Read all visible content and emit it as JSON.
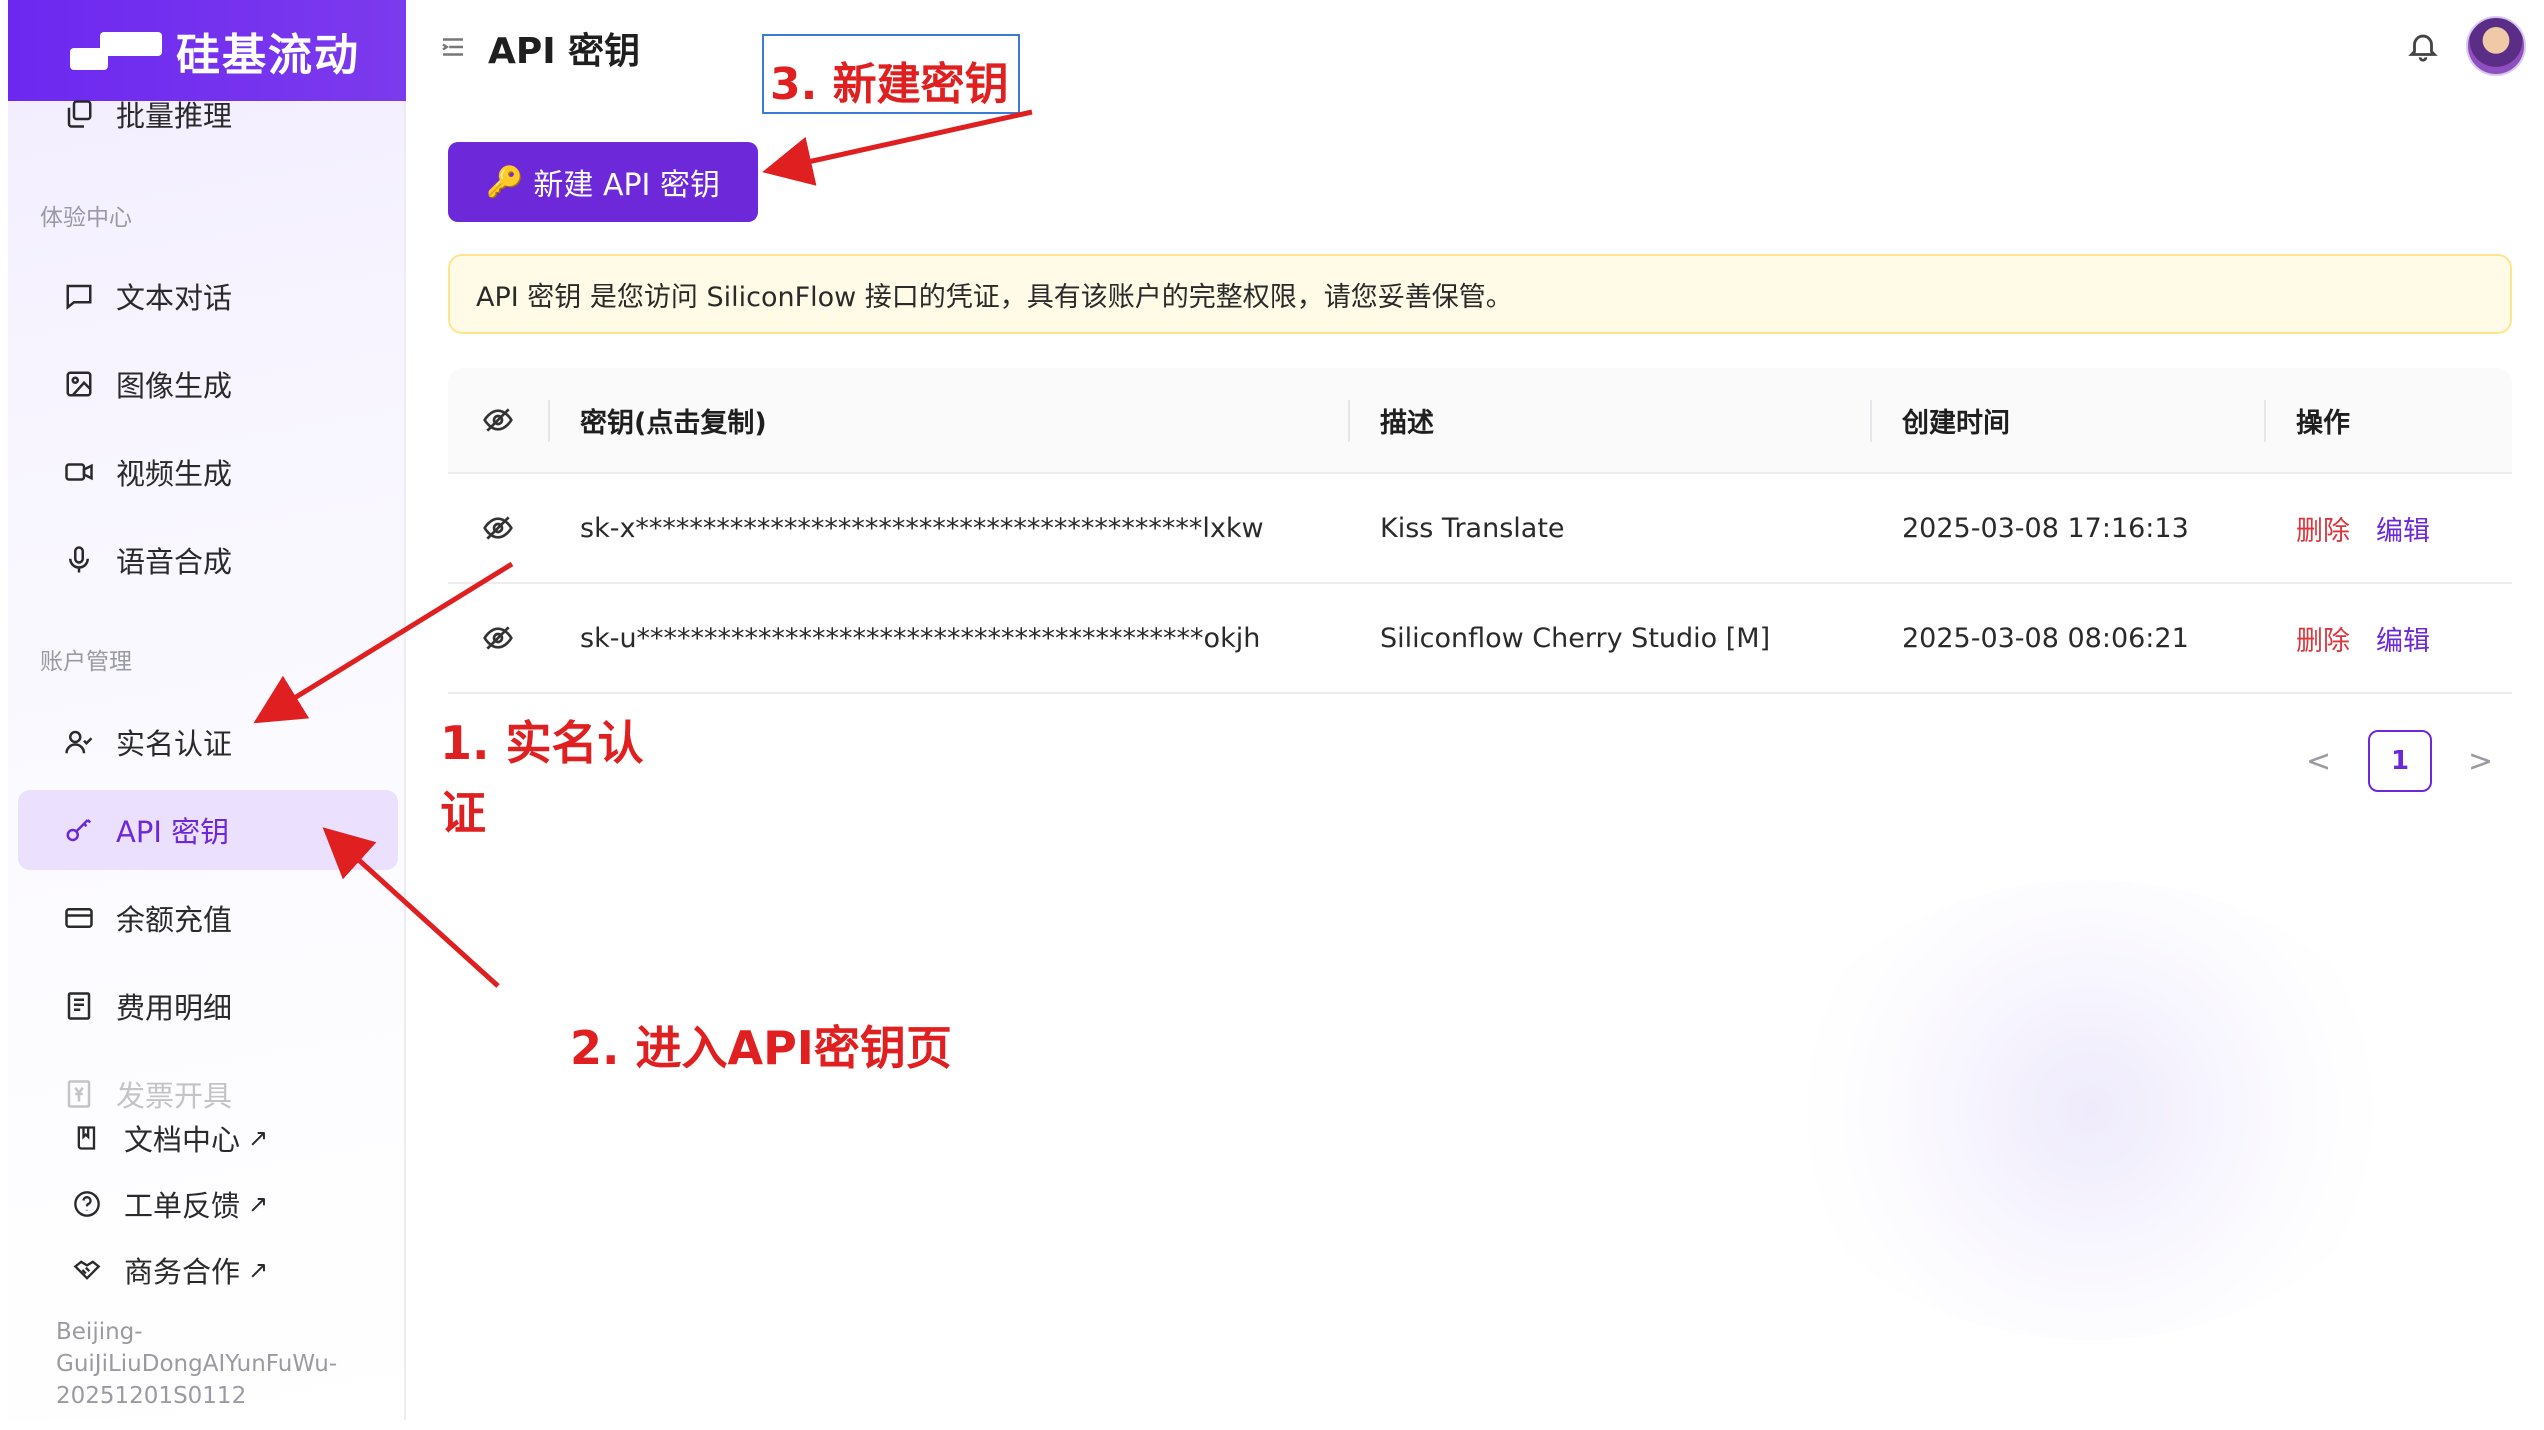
{
  "brand": {
    "name": "硅基流动"
  },
  "header": {
    "title": "API 密钥"
  },
  "sidebar": {
    "items_top": [
      {
        "label": "批量推理",
        "icon": "copy-stack-icon"
      }
    ],
    "section_experience": "体验中心",
    "experience_items": [
      {
        "label": "文本对话",
        "icon": "chat-icon"
      },
      {
        "label": "图像生成",
        "icon": "image-icon"
      },
      {
        "label": "视频生成",
        "icon": "video-icon"
      },
      {
        "label": "语音合成",
        "icon": "microphone-icon"
      }
    ],
    "section_account": "账户管理",
    "account_items": [
      {
        "label": "实名认证",
        "icon": "user-check-icon"
      },
      {
        "label": "API 密钥",
        "icon": "key-icon",
        "active": true
      },
      {
        "label": "余额充值",
        "icon": "card-icon"
      },
      {
        "label": "费用明细",
        "icon": "receipt-icon"
      },
      {
        "label": "发票开具",
        "icon": "invoice-icon",
        "disabled": true
      }
    ],
    "links": [
      {
        "label": "文档中心",
        "ext": "↗",
        "icon": "book-icon"
      },
      {
        "label": "工单反馈",
        "ext": "↗",
        "icon": "help-icon"
      },
      {
        "label": "商务合作",
        "ext": "↗",
        "icon": "handshake-icon"
      }
    ],
    "footer": "Beijing-GuiJiLiuDongAIYunFuWu-20251201S0112"
  },
  "main": {
    "new_button": "新建 API 密钥",
    "notice": "API 密钥 是您访问 SiliconFlow 接口的凭证，具有该账户的完整权限，请您妥善保管。",
    "table": {
      "headers": [
        "密钥(点击复制)",
        "描述",
        "创建时间",
        "操作"
      ],
      "rows": [
        {
          "key": "sk-x******************************************lxkw",
          "desc": "Kiss Translate",
          "created": "2025-03-08 17:16:13",
          "delete": "删除",
          "edit": "编辑"
        },
        {
          "key": "sk-u******************************************okjh",
          "desc": "Siliconflow Cherry Studio [M]",
          "created": "2025-03-08 08:06:21",
          "delete": "删除",
          "edit": "编辑"
        }
      ]
    },
    "pagination": {
      "prev": "<",
      "current": "1",
      "next": ">"
    }
  },
  "annotations": {
    "step1": "1. 实名认证",
    "step2": "2. 进入API密钥页",
    "step3": "3. 新建密钥"
  },
  "colors": {
    "brand": "#6d28d9",
    "danger": "#d9363e",
    "annotation": "#e02020",
    "notice_bg": "#fffbe6"
  }
}
